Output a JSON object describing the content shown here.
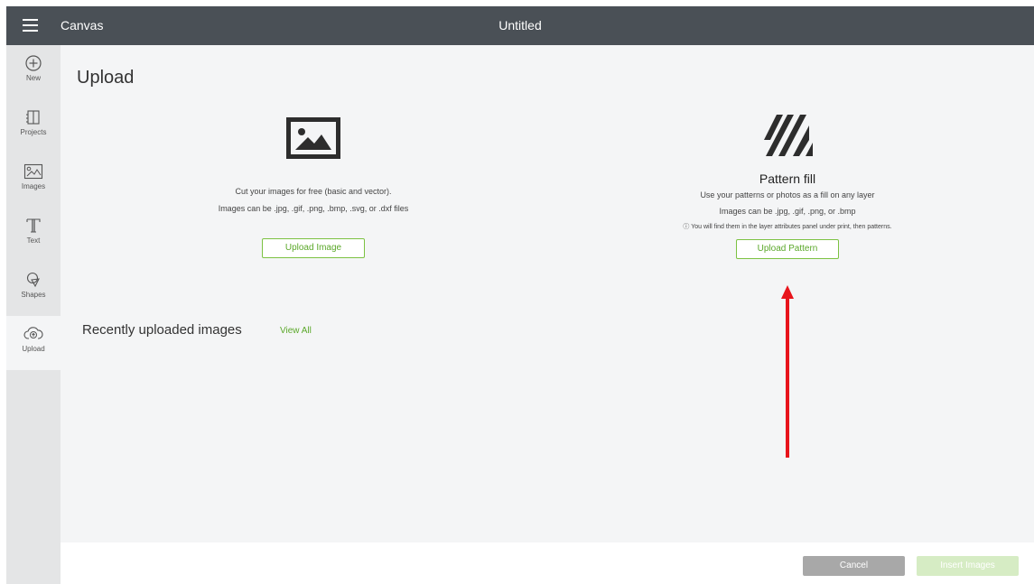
{
  "header": {
    "app_title": "Canvas",
    "doc_title": "Untitled",
    "menu_icon": "hamburger-menu-icon"
  },
  "sidebar": {
    "items": [
      {
        "label": "New",
        "icon": "plus-circle-icon"
      },
      {
        "label": "Projects",
        "icon": "projects-icon"
      },
      {
        "label": "Images",
        "icon": "image-icon"
      },
      {
        "label": "Text",
        "icon": "text-icon"
      },
      {
        "label": "Shapes",
        "icon": "shapes-icon"
      },
      {
        "label": "Upload",
        "icon": "cloud-upload-icon",
        "active": true
      }
    ]
  },
  "main": {
    "heading": "Upload",
    "upload_image": {
      "line1": "Cut your images for free (basic and vector).",
      "line2": "Images can be .jpg, .gif, .png, .bmp, .svg, or .dxf files",
      "button_label": "Upload Image"
    },
    "pattern_fill": {
      "title": "Pattern fill",
      "line1": "Use your patterns or photos as a fill on any layer",
      "line2": "Images can be .jpg, .gif, .png, or .bmp",
      "info": "ⓘ You will find them in the layer attributes panel under print, then patterns.",
      "button_label": "Upload Pattern"
    },
    "recent": {
      "title": "Recently uploaded images",
      "view_all": "View All"
    }
  },
  "footer": {
    "cancel_label": "Cancel",
    "insert_label": "Insert Images"
  },
  "colors": {
    "topbar": "#4a5056",
    "accent_green": "#7cc242",
    "annotation_arrow": "#e8141b"
  }
}
